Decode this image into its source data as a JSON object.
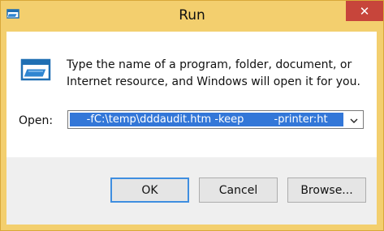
{
  "window": {
    "title": "Run",
    "close_glyph": "✕",
    "app_icon": "run-icon",
    "accent_color": "#f3cf6e",
    "close_color": "#c7453b"
  },
  "body": {
    "description": "Type the name of a program, folder, document, or Internet resource, and Windows will open it for you.",
    "icon": "run-icon"
  },
  "open": {
    "label": "Open:",
    "value": "     -fC:\\temp\\dddaudit.htm -keep         -printer:ht"
  },
  "buttons": {
    "ok": "OK",
    "cancel": "Cancel",
    "browse": "Browse..."
  }
}
